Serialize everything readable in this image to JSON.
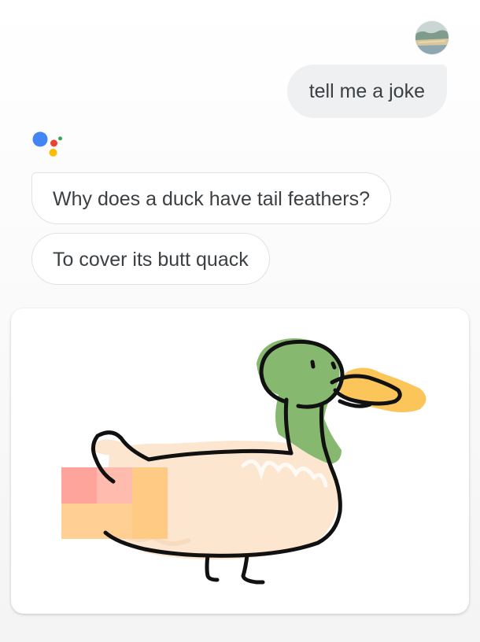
{
  "conversation": {
    "user_message": "tell me a joke",
    "assistant_messages": [
      "Why does a duck have tail feathers?",
      "To cover its butt quack"
    ]
  },
  "icons": {
    "avatar": "user-avatar-landscape",
    "assistant": "google-assistant-logo"
  },
  "colors": {
    "assistant_blue": "#4285f4",
    "assistant_red": "#ea4335",
    "assistant_yellow": "#fbbc04",
    "assistant_green": "#34a853",
    "duck_head": "#86b86f",
    "duck_beak": "#fbc55a",
    "duck_body": "#fde6cf"
  }
}
